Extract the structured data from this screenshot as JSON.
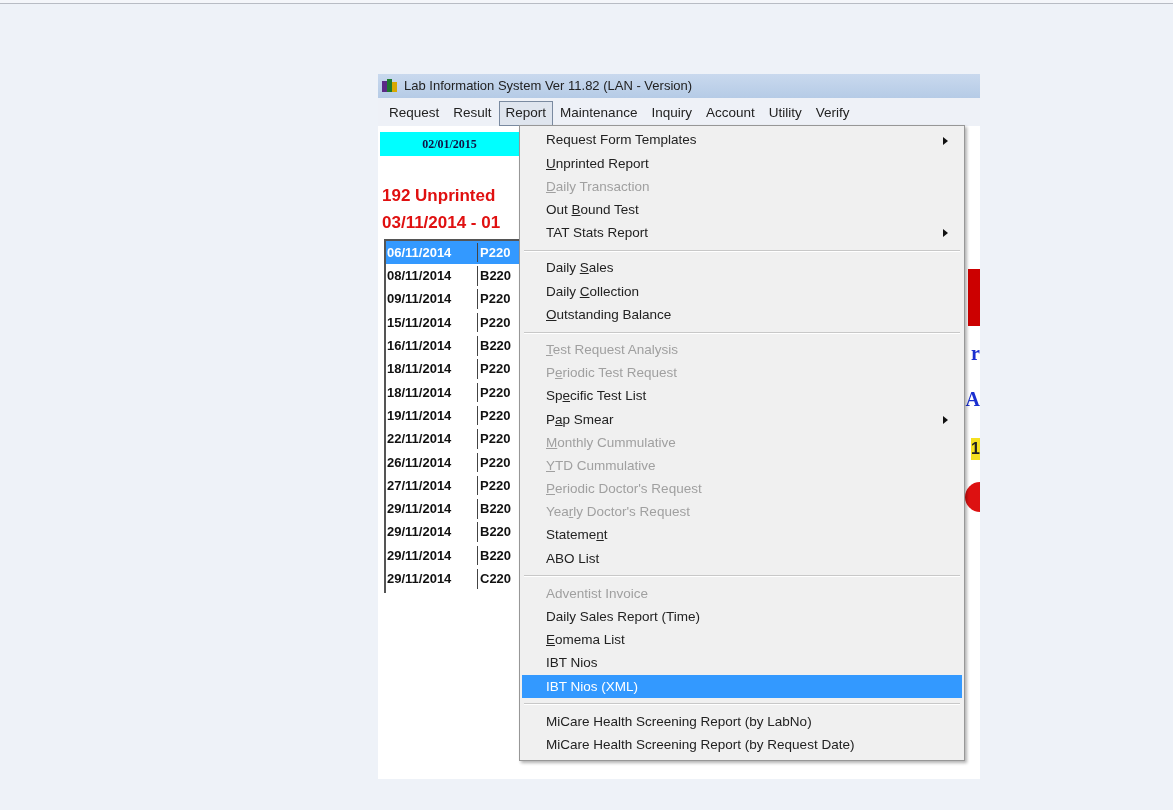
{
  "window": {
    "title": "Lab Information System Ver 11.82 (LAN - Version)"
  },
  "menubar": [
    {
      "label": "Request",
      "selected": false
    },
    {
      "label": "Result",
      "selected": false
    },
    {
      "label": "Report",
      "selected": true
    },
    {
      "label": "Maintenance",
      "selected": false
    },
    {
      "label": "Inquiry",
      "selected": false
    },
    {
      "label": "Account",
      "selected": false
    },
    {
      "label": "Utility",
      "selected": false
    },
    {
      "label": "Verify",
      "selected": false
    }
  ],
  "date_box": "02/01/2015",
  "unprinted_heading": "192 Unprinted",
  "date_range": "03/11/2014 - 01",
  "list": {
    "rows": [
      {
        "date": "06/11/2014",
        "code": "P220",
        "selected": true
      },
      {
        "date": "08/11/2014",
        "code": "B220",
        "selected": false
      },
      {
        "date": "09/11/2014",
        "code": "P220",
        "selected": false
      },
      {
        "date": "15/11/2014",
        "code": "P220",
        "selected": false
      },
      {
        "date": "16/11/2014",
        "code": "B220",
        "selected": false
      },
      {
        "date": "18/11/2014",
        "code": "P220",
        "selected": false
      },
      {
        "date": "18/11/2014",
        "code": "P220",
        "selected": false
      },
      {
        "date": "19/11/2014",
        "code": "P220",
        "selected": false
      },
      {
        "date": "22/11/2014",
        "code": "P220",
        "selected": false
      },
      {
        "date": "26/11/2014",
        "code": "P220",
        "selected": false
      },
      {
        "date": "27/11/2014",
        "code": "P220",
        "selected": false
      },
      {
        "date": "29/11/2014",
        "code": "B220",
        "selected": false
      },
      {
        "date": "29/11/2014",
        "code": "B220",
        "selected": false
      },
      {
        "date": "29/11/2014",
        "code": "B220",
        "selected": false
      },
      {
        "date": "29/11/2014",
        "code": "C220",
        "selected": false
      }
    ]
  },
  "right_edge": [
    {
      "kind": "bar",
      "color": "#cc0000"
    },
    {
      "kind": "text",
      "text": "r",
      "color": "#1a2fd0"
    },
    {
      "kind": "text",
      "text": "A",
      "color": "#1a2fd0"
    },
    {
      "kind": "badge",
      "text": "1",
      "color": "#f5e020"
    },
    {
      "kind": "dot",
      "color": "#dd1111"
    }
  ],
  "report_menu": [
    {
      "kind": "item",
      "label": {
        "after": "Request Form Templates"
      },
      "disabled": false,
      "selected": false,
      "submenu": true
    },
    {
      "kind": "item",
      "label": {
        "key": "U",
        "after": "nprinted Report"
      },
      "disabled": false,
      "selected": false,
      "submenu": false
    },
    {
      "kind": "item",
      "label": {
        "key": "D",
        "after": "aily Transaction"
      },
      "disabled": true,
      "selected": false,
      "submenu": false
    },
    {
      "kind": "item",
      "label": {
        "before": "Out ",
        "key": "B",
        "after": "ound Test"
      },
      "disabled": false,
      "selected": false,
      "submenu": false
    },
    {
      "kind": "item",
      "label": {
        "after": "TAT Stats Report"
      },
      "disabled": false,
      "selected": false,
      "submenu": true
    },
    {
      "kind": "separator"
    },
    {
      "kind": "item",
      "label": {
        "before": "Daily ",
        "key": "S",
        "after": "ales"
      },
      "disabled": false,
      "selected": false,
      "submenu": false
    },
    {
      "kind": "item",
      "label": {
        "before": "Daily ",
        "key": "C",
        "after": "ollection"
      },
      "disabled": false,
      "selected": false,
      "submenu": false
    },
    {
      "kind": "item",
      "label": {
        "key": "O",
        "after": "utstanding Balance"
      },
      "disabled": false,
      "selected": false,
      "submenu": false
    },
    {
      "kind": "separator"
    },
    {
      "kind": "item",
      "label": {
        "key": "T",
        "after": "est Request Analysis"
      },
      "disabled": true,
      "selected": false,
      "submenu": false
    },
    {
      "kind": "item",
      "label": {
        "before": "P",
        "key": "e",
        "after": "riodic Test Request"
      },
      "disabled": true,
      "selected": false,
      "submenu": false
    },
    {
      "kind": "item",
      "label": {
        "before": "Sp",
        "key": "e",
        "after": "cific Test List"
      },
      "disabled": false,
      "selected": false,
      "submenu": false
    },
    {
      "kind": "item",
      "label": {
        "before": "P",
        "key": "a",
        "after": "p Smear"
      },
      "disabled": false,
      "selected": false,
      "submenu": true
    },
    {
      "kind": "item",
      "label": {
        "key": "M",
        "after": "onthly Cummulative"
      },
      "disabled": true,
      "selected": false,
      "submenu": false
    },
    {
      "kind": "item",
      "label": {
        "key": "Y",
        "after": "TD Cummulative"
      },
      "disabled": true,
      "selected": false,
      "submenu": false
    },
    {
      "kind": "item",
      "label": {
        "key": "P",
        "after": "eriodic Doctor's Request"
      },
      "disabled": true,
      "selected": false,
      "submenu": false
    },
    {
      "kind": "item",
      "label": {
        "before": "Yea",
        "key": "r",
        "after": "ly Doctor's Request"
      },
      "disabled": true,
      "selected": false,
      "submenu": false
    },
    {
      "kind": "item",
      "label": {
        "before": "Stateme",
        "key": "n",
        "after": "t"
      },
      "disabled": false,
      "selected": false,
      "submenu": false
    },
    {
      "kind": "item",
      "label": {
        "after": "ABO List"
      },
      "disabled": false,
      "selected": false,
      "submenu": false
    },
    {
      "kind": "separator"
    },
    {
      "kind": "item",
      "label": {
        "after": "Adventist Invoice"
      },
      "disabled": true,
      "selected": false,
      "submenu": false
    },
    {
      "kind": "item",
      "label": {
        "after": "Daily Sales Report (Time)"
      },
      "disabled": false,
      "selected": false,
      "submenu": false
    },
    {
      "kind": "item",
      "label": {
        "key": "E",
        "after": "omema List"
      },
      "disabled": false,
      "selected": false,
      "submenu": false
    },
    {
      "kind": "item",
      "label": {
        "after": "IBT Nios"
      },
      "disabled": false,
      "selected": false,
      "submenu": false
    },
    {
      "kind": "item",
      "label": {
        "after": "IBT Nios (XML)"
      },
      "disabled": false,
      "selected": true,
      "submenu": false
    },
    {
      "kind": "separator"
    },
    {
      "kind": "item",
      "label": {
        "after": "MiCare Health Screening Report (by LabNo)"
      },
      "disabled": false,
      "selected": false,
      "submenu": false
    },
    {
      "kind": "item",
      "label": {
        "after": "MiCare Health Screening Report (by Request Date)"
      },
      "disabled": false,
      "selected": false,
      "submenu": false
    }
  ]
}
